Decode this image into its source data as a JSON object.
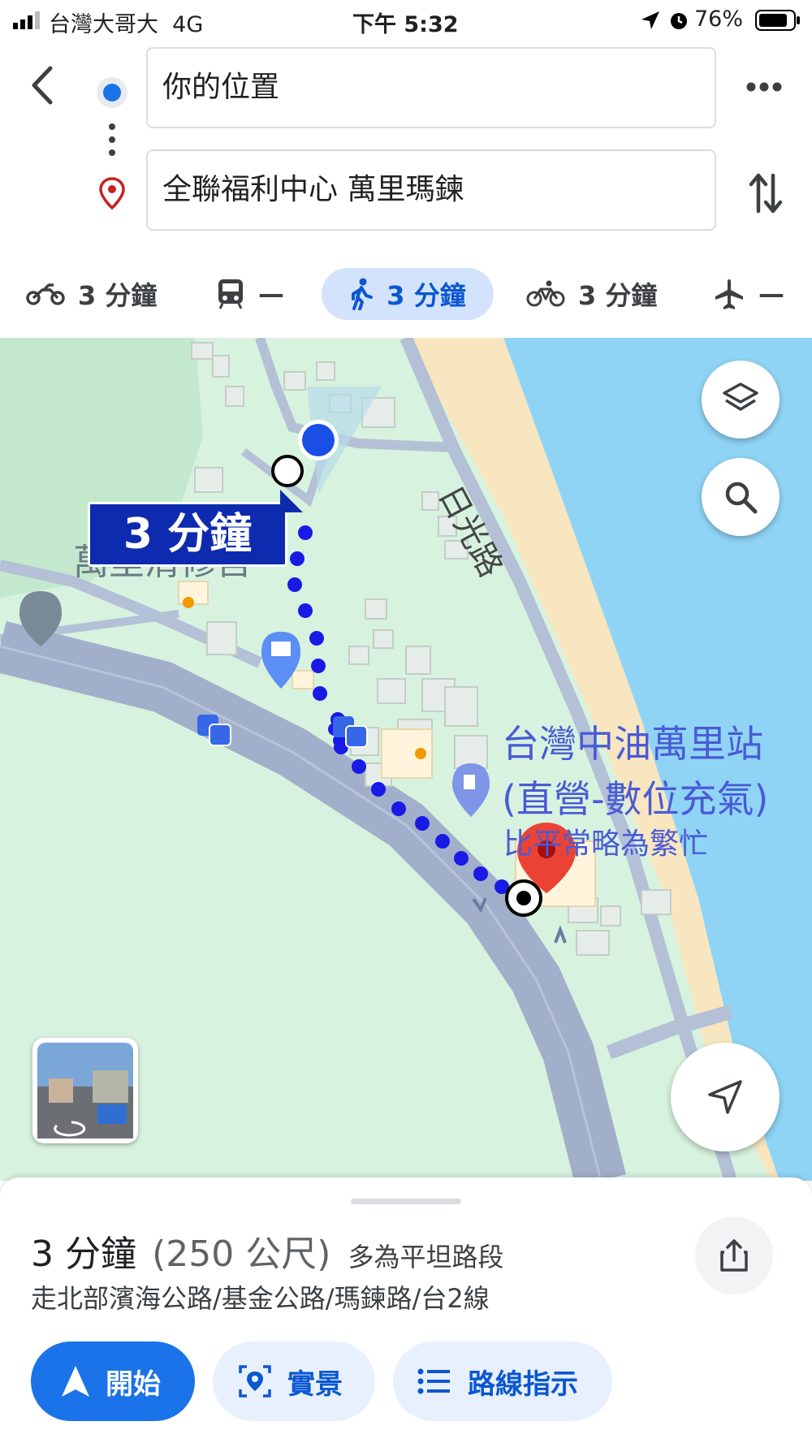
{
  "status_bar": {
    "carrier": "台灣大哥大",
    "network": "4G",
    "time": "下午 5:32",
    "battery": "76%"
  },
  "search": {
    "origin": "你的位置",
    "destination": "全聯福利中心 萬里瑪鍊"
  },
  "modes": [
    {
      "icon": "motorcycle-icon",
      "label": "3 分鐘"
    },
    {
      "icon": "transit-icon",
      "label": "—"
    },
    {
      "icon": "walking-icon",
      "label": "3 分鐘",
      "active": true
    },
    {
      "icon": "bicycle-icon",
      "label": "3 分鐘"
    },
    {
      "icon": "flight-icon",
      "label": "—"
    }
  ],
  "map": {
    "route_time_badge": "3 分鐘",
    "road_label": "日光路",
    "place_temple": "萬里清修宮",
    "place_gas_line1": "台灣中油萬里站",
    "place_gas_line2": "(直營-數位充氣)",
    "place_gas_busy": "比平常略為繁忙",
    "colors": {
      "route": "#1a1ae6",
      "water": "#8fd4f5",
      "sand": "#f7e6c0",
      "land": "#d7f2de",
      "road": "#aab6cf"
    }
  },
  "route_summary": {
    "duration": "3 分鐘",
    "distance": "(250 公尺)",
    "terrain": "多為平坦路段",
    "via": "走北部濱海公路/基金公路/瑪鍊路/台2線"
  },
  "actions": {
    "start": "開始",
    "live_view": "實景",
    "directions": "路線指示"
  }
}
